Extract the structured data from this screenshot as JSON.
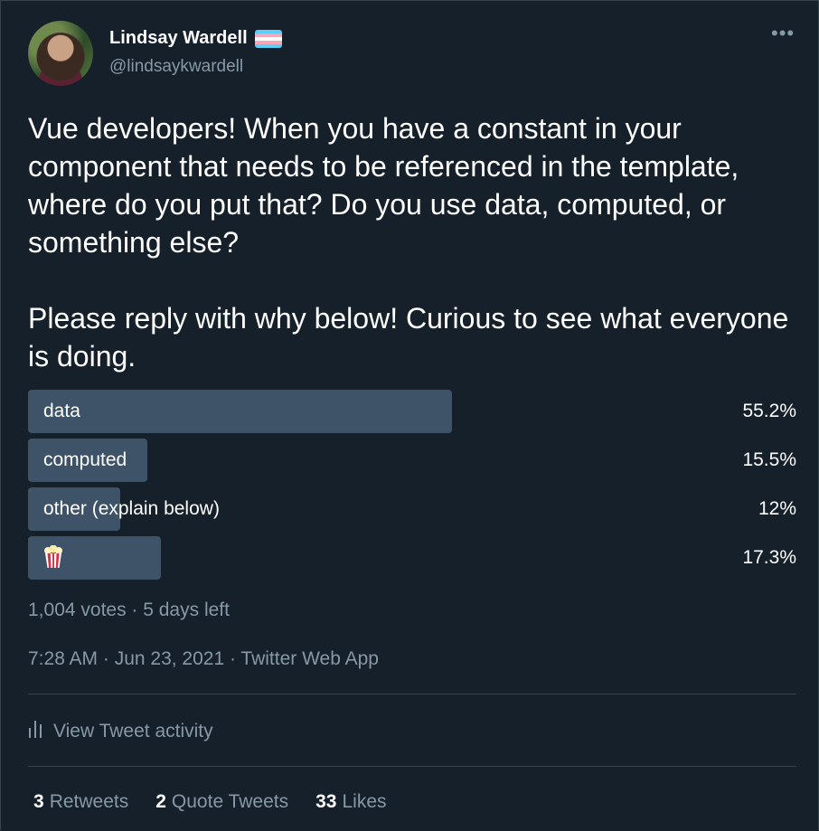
{
  "author": {
    "display_name": "Lindsay Wardell",
    "handle": "@lindsaykwardell",
    "flag_colors": [
      "#5bcefa",
      "#f5a9b8",
      "#ffffff",
      "#f5a9b8",
      "#5bcefa"
    ]
  },
  "tweet": {
    "paragraphs": [
      "Vue developers! When you have a constant in your component that needs to be referenced in the template, where do you put that? Do you use data, computed, or something else?",
      "Please reply with why below! Curious to see what everyone is doing."
    ]
  },
  "poll": {
    "options": [
      {
        "label": "data",
        "percent": "55.2%",
        "value": 55.2
      },
      {
        "label": "computed",
        "percent": "15.5%",
        "value": 15.5
      },
      {
        "label": "other (explain below)",
        "percent": "12%",
        "value": 12
      },
      {
        "label": "",
        "icon": "popcorn-icon",
        "percent": "17.3%",
        "value": 17.3
      }
    ],
    "summary": "1,004 votes · 5 days left"
  },
  "timestamp": "7:28 AM · Jun 23, 2021 · Twitter Web App",
  "activity_label": "View Tweet activity",
  "stats": [
    {
      "count": "3",
      "label": "Retweets"
    },
    {
      "count": "2",
      "label": "Quote Tweets"
    },
    {
      "count": "33",
      "label": "Likes"
    }
  ],
  "colors": {
    "background": "#15202b",
    "poll_bar": "#3e5368",
    "secondary_text": "#8899a6",
    "divider": "#38444d"
  }
}
